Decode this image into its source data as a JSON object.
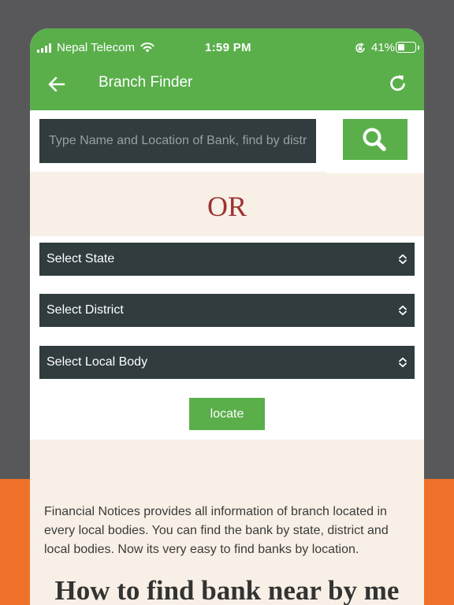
{
  "status_bar": {
    "carrier": "Nepal Telecom",
    "time": "1:59 PM",
    "battery": "41%"
  },
  "header": {
    "title": "Branch Finder",
    "back_icon": "arrow-left-icon",
    "refresh_icon": "refresh-icon"
  },
  "search": {
    "placeholder": "Type Name and Location of Bank, find by district",
    "value": "",
    "button_icon": "search-icon"
  },
  "divider": {
    "or_label": "OR"
  },
  "filters": {
    "state": "Select State",
    "district": "Select District",
    "local_body": "Select Local Body"
  },
  "actions": {
    "locate_label": "locate"
  },
  "info": {
    "description": "Financial Notices provides all information of branch located in every local bodies. You can find the bank by state, district and local bodies. Now its very easy to find banks by location.",
    "heading": "How to find bank near by me"
  },
  "colors": {
    "accent_green": "#5aaf4b",
    "dark_field": "#303c3e",
    "or_red": "#9c3232",
    "cream": "#f8f0e6",
    "orange": "#f0722a"
  }
}
